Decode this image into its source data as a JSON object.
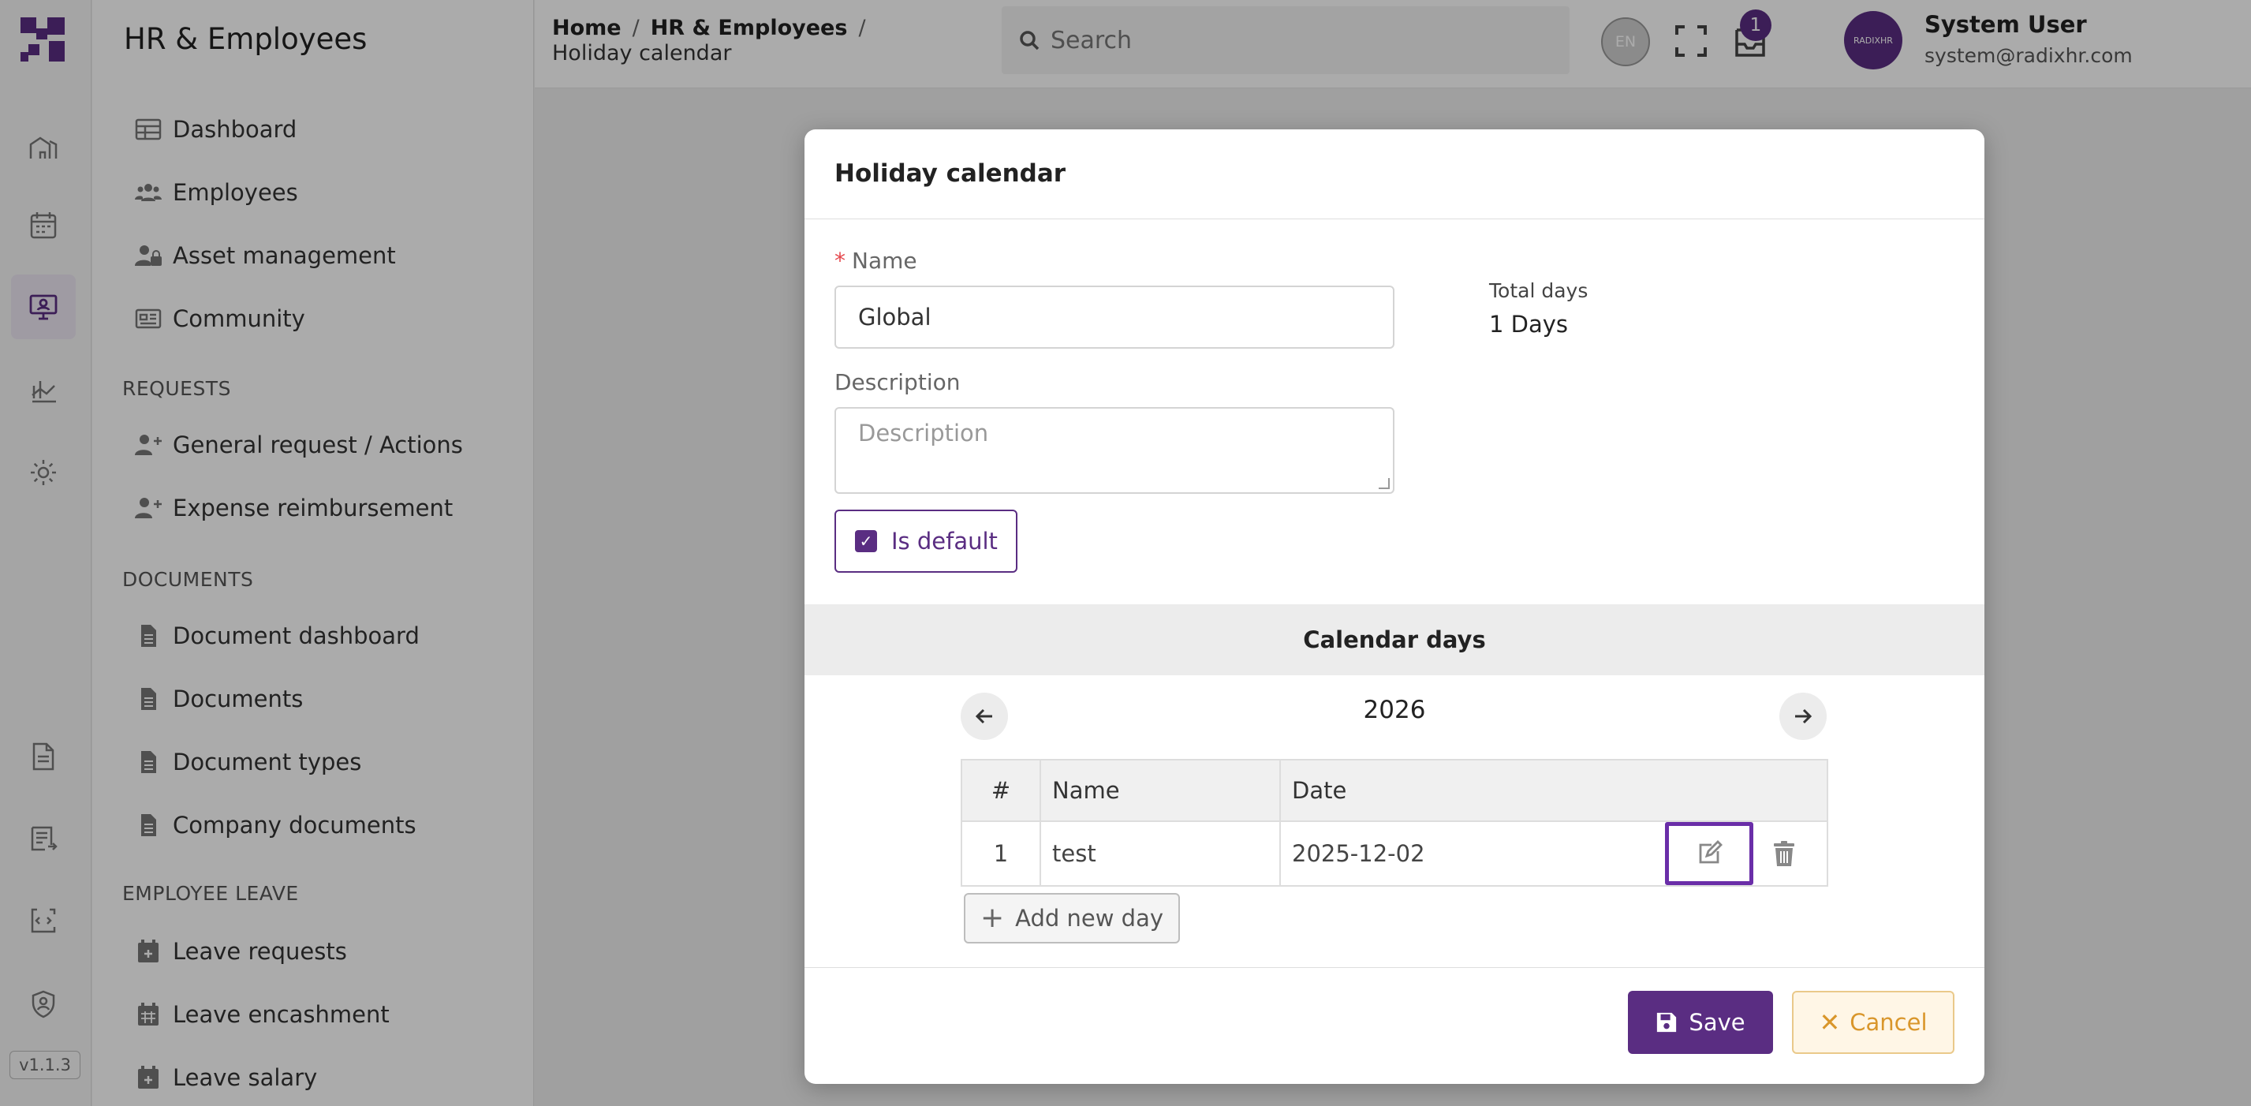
{
  "app": {
    "section_title": "HR & Employees",
    "version": "v1.1.3"
  },
  "sidebar": {
    "items": [
      {
        "label": "Dashboard",
        "icon": "table-icon"
      },
      {
        "label": "Employees",
        "icon": "users-icon"
      },
      {
        "label": "Asset management",
        "icon": "user-lock-icon"
      },
      {
        "label": "Community",
        "icon": "newspaper-icon"
      }
    ],
    "requests_heading": "REQUESTS",
    "requests": [
      {
        "label": "General request / Actions",
        "icon": "user-plus-icon"
      },
      {
        "label": "Expense reimbursement",
        "icon": "user-plus-icon"
      }
    ],
    "documents_heading": "DOCUMENTS",
    "documents": [
      {
        "label": "Document dashboard",
        "icon": "file-icon"
      },
      {
        "label": "Documents",
        "icon": "file-icon"
      },
      {
        "label": "Document types",
        "icon": "file-icon"
      },
      {
        "label": "Company documents",
        "icon": "file-icon"
      }
    ],
    "leave_heading": "EMPLOYEE LEAVE",
    "leave": [
      {
        "label": "Leave requests",
        "icon": "calendar-plus-icon"
      },
      {
        "label": "Leave encashment",
        "icon": "calendar-icon"
      },
      {
        "label": "Leave salary",
        "icon": "calendar-plus-icon"
      }
    ]
  },
  "topbar": {
    "breadcrumb": {
      "home": "Home",
      "section": "HR & Employees",
      "current": "Holiday calendar",
      "separator": "/"
    },
    "search_placeholder": "Search",
    "language": "EN",
    "notification_count": "1",
    "avatar_text": "RADIXHR",
    "user_name": "System User",
    "user_email": "system@radixhr.com"
  },
  "modal": {
    "title": "Holiday calendar",
    "name_label": "Name",
    "name_value": "Global",
    "description_label": "Description",
    "description_placeholder": "Description",
    "total_days_label": "Total days",
    "total_days_value": "1 Days",
    "is_default_label": "Is default",
    "is_default_checked": true,
    "calendar_days_heading": "Calendar days",
    "year": "2026",
    "table": {
      "headers": [
        "#",
        "Name",
        "Date"
      ],
      "rows": [
        {
          "index": "1",
          "name": "test",
          "date": "2025-12-02"
        }
      ]
    },
    "add_day_label": "Add new day",
    "save_label": "Save",
    "cancel_label": "Cancel"
  },
  "colors": {
    "brand": "#5a2d82",
    "cancel": "#d9962b",
    "danger": "#e5484d"
  }
}
